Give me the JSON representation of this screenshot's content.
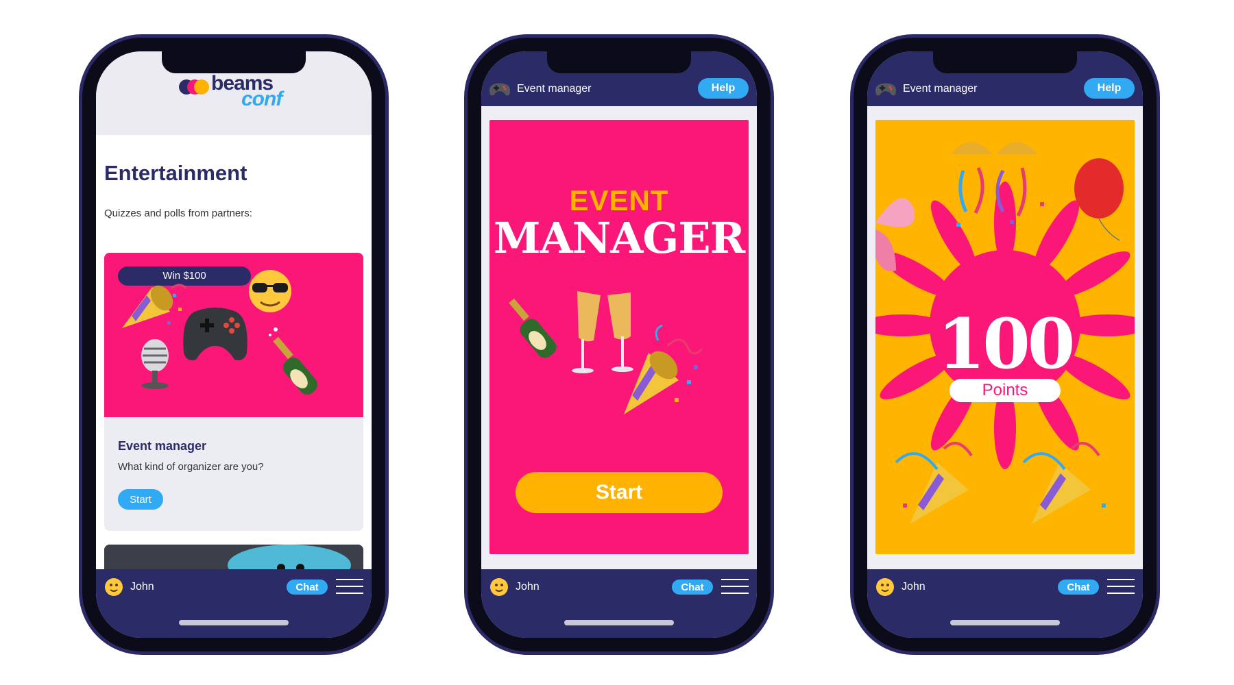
{
  "colors": {
    "navy": "#2b2b68",
    "accent_blue": "#31a9f3",
    "pink": "#fb1778",
    "gold": "#ffb300"
  },
  "phone1": {
    "logo": {
      "line1": "beams",
      "line2": "conf"
    },
    "title": "Entertainment",
    "subtitle": "Quizzes and polls from partners:",
    "card": {
      "badge": "Win $100",
      "title": "Event manager",
      "description": "What kind of organizer are you?",
      "start_label": "Start",
      "icons": [
        "party-popper-icon",
        "sunglasses-emoji-icon",
        "gamepad-icon",
        "microphone-icon",
        "champagne-bottle-icon"
      ]
    }
  },
  "phone2": {
    "topbar": {
      "title": "Event manager",
      "help_label": "Help"
    },
    "panel": {
      "line1": "EVENT",
      "line2": "MANAGER",
      "start_label": "Start"
    }
  },
  "phone3": {
    "topbar": {
      "title": "Event manager",
      "help_label": "Help"
    },
    "result": {
      "points": "100",
      "label": "Points"
    }
  },
  "bottombar": {
    "user": "John",
    "chat_label": "Chat"
  }
}
